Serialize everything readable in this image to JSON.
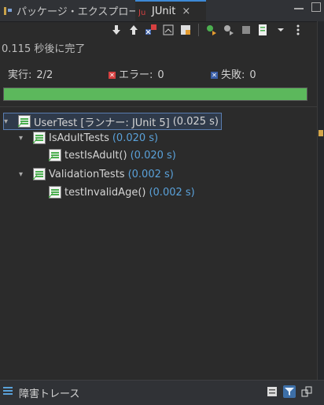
{
  "tabs": {
    "package_explorer": "パッケージ・エクスプローラー",
    "junit": "JUnit",
    "close": "×"
  },
  "status": {
    "finished": "0.115 秒後に完了"
  },
  "stats": {
    "runs_label": "実行:",
    "runs_value": "2/2",
    "errors_label": "エラー:",
    "errors_value": "0",
    "failures_label": "失敗:",
    "failures_value": "0"
  },
  "progress": {
    "fraction": 1.0,
    "color": "#5cb85c"
  },
  "tree": [
    {
      "name": "UserTest [ランナー: JUnit 5]",
      "time": "(0.025 s)",
      "expanded": true
    },
    {
      "name": "IsAdultTests",
      "time": "(0.020 s)",
      "expanded": true
    },
    {
      "name": "testIsAdult()",
      "time": "(0.020 s)"
    },
    {
      "name": "ValidationTests",
      "time": "(0.002 s)",
      "expanded": true
    },
    {
      "name": "testInvalidAge()",
      "time": "(0.002 s)"
    }
  ],
  "failure_trace": {
    "label": "障害トレース"
  },
  "colors": {
    "accent": "#3d89d6",
    "time_text": "#5aa1d9",
    "success": "#5cb85c",
    "error": "#d64040"
  },
  "icons": {
    "toolbar": [
      "next-failure-icon",
      "previous-failure-icon",
      "show-failures-only-icon",
      "scroll-lock-icon",
      "history-icon",
      "rerun-icon",
      "rerun-failed-first-icon",
      "stop-icon",
      "test-run-history-icon",
      "view-menu-icon"
    ],
    "bottom": [
      "compare-result-icon",
      "filter-stack-trace-icon",
      "copy-trace-icon"
    ]
  }
}
